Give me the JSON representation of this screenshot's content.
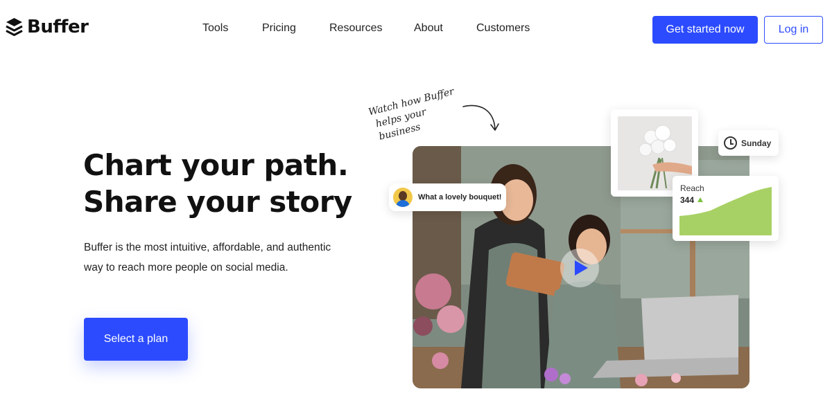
{
  "header": {
    "brand": "Buffer",
    "nav": [
      "Tools",
      "Pricing",
      "Resources",
      "About",
      "Customers"
    ],
    "get_started_label": "Get started now",
    "login_label": "Log in"
  },
  "hero": {
    "title_line1": "Chart your path.",
    "title_line2": "Share your story",
    "description": "Buffer is the most intuitive, affordable, and authentic way to reach more people on social media.",
    "cta_label": "Select a plan"
  },
  "media": {
    "handwriting_line1": "Watch how Buffer",
    "handwriting_line2": "helps your business",
    "comment": "What a lovely bouquet!",
    "schedule_day": "Sunday",
    "reach_label": "Reach",
    "reach_value": "344"
  },
  "colors": {
    "brand_blue": "#2c4bff",
    "reach_green": "#a8d165"
  }
}
